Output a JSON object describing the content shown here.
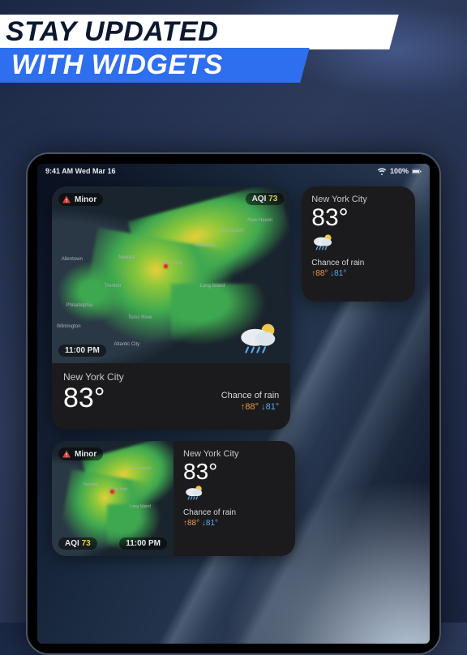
{
  "headline": {
    "line1": "STAY UPDATED",
    "line2": "WITH WIDGETS"
  },
  "statusbar": {
    "time_date": "9:41 AM   Wed Mar 16",
    "battery_pct": "100%"
  },
  "widgets": {
    "large": {
      "alert_label": "Minor",
      "aqi_label": "AQI",
      "aqi_value": "73",
      "time": "11:00 PM",
      "city": "New York City",
      "temp": "83°",
      "condition": "Chance of rain",
      "hi": "88°",
      "lo": "81°",
      "map_cities": [
        "Newark",
        "New York",
        "Long Island",
        "Philadelphia",
        "Trenton",
        "Bridgeport",
        "New Haven",
        "Stamford",
        "Allentown",
        "Wilmington",
        "Atlantic City",
        "Toms River"
      ]
    },
    "small": {
      "city": "New York City",
      "temp": "83°",
      "condition": "Chance of rain",
      "hi": "88°",
      "lo": "81°"
    },
    "medium": {
      "alert_label": "Minor",
      "aqi_label": "AQI",
      "aqi_value": "73",
      "time": "11:00 PM",
      "city": "New York City",
      "temp": "83°",
      "condition": "Chance of rain",
      "hi": "88°",
      "lo": "81°"
    }
  },
  "colors": {
    "accent_blue": "#2d6fef",
    "hi": "#e89850",
    "lo": "#58a8e8",
    "aqi": "#e8c848"
  }
}
